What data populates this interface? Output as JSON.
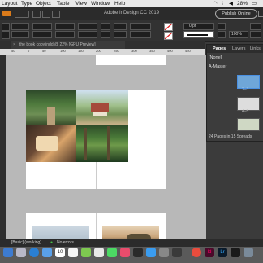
{
  "menubar": {
    "items": [
      "Layout",
      "Type",
      "Object",
      "Table",
      "View",
      "Window",
      "Help"
    ],
    "battery": "28%"
  },
  "titlebar": {
    "title": "Adobe InDesign CC 2019",
    "publish_label": "Publish Online"
  },
  "control_panel": {
    "stroke_value": "0 pt",
    "zoom_value": "100%"
  },
  "document_tab": {
    "label": "the book copy.indd @ 22% [GPU Preview]"
  },
  "ruler": {
    "ticks": [
      "50",
      "0",
      "50",
      "100",
      "150",
      "200",
      "250",
      "300",
      "350",
      "400",
      "450"
    ]
  },
  "pages_panel": {
    "tabs": [
      "Pages",
      "Layers",
      "Links"
    ],
    "none_label": "[None]",
    "master_label": "A-Master",
    "spread_labels": [
      "2–3",
      "4–5"
    ],
    "summary": "24 Pages in 15 Spreads"
  },
  "status_bar": {
    "style": "[Basic] (working)",
    "errors": "No errors"
  },
  "dock": {
    "items": [
      "finder",
      "launchpad",
      "safari",
      "mail",
      "maps",
      "photos",
      "calendar",
      "notes",
      "reminders",
      "messages",
      "facetime",
      "music",
      "app-store",
      "settings",
      "chrome",
      "indesign",
      "lightroom",
      "photoshop",
      "bridge"
    ],
    "calendar_day": "10"
  },
  "colors": {
    "accent": "#4a90e2",
    "forest_dark": "#1f3a1f",
    "forest_mid": "#3e6a36",
    "sky": "#cfe0f0",
    "warm": "#d9a46a"
  }
}
